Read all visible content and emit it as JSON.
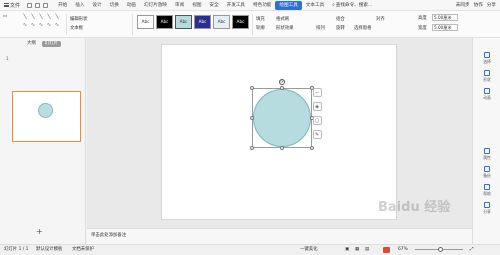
{
  "menubar": {
    "file_label": "文件",
    "tabs": [
      "开始",
      "插入",
      "设计",
      "切换",
      "动画",
      "幻灯片放映",
      "审阅",
      "视图",
      "安全",
      "开发工具",
      "特色功能",
      "绘图工具",
      "文本工具"
    ],
    "active_tab": "绘图工具",
    "search_label": "查找命令、搜索...",
    "right_items": [
      "未同步",
      "协作",
      "分享"
    ]
  },
  "ribbon": {
    "edit_shape": "编辑形状",
    "text_box": "文本框",
    "style_labels": [
      "Abc",
      "Abc",
      "Abc",
      "Abc",
      "Abc",
      "Abc"
    ],
    "fill_label": "填充",
    "outline_label": "轮廓",
    "shape_effect": "形状效果",
    "format_brush": "格式刷",
    "arrange": "排列",
    "group": "组合",
    "rotate": "旋转",
    "select_pane": "选择窗格",
    "align": "对齐",
    "height_label": "高度",
    "height_value": "5.00厘米",
    "width_label": "宽度",
    "width_value": "5.00厘米"
  },
  "left_panel": {
    "tab_outline": "大纲",
    "tab_slides": "幻灯片",
    "slide_number": "1",
    "add_slide": "+"
  },
  "canvas": {
    "notes_placeholder": "单击此处添加备注",
    "rotate_symbol": "⟳"
  },
  "right_bar": {
    "items": [
      "选择",
      "形状",
      "动画",
      "属性",
      "备份",
      "帮助",
      "分享"
    ]
  },
  "status": {
    "slide_info": "幻灯片 1 / 1",
    "theme": "默认设计模板",
    "backup": "文档未保护",
    "note_toggle": "一键美化",
    "zoom": "67%"
  },
  "watermark": "Baidu 经验",
  "colors": {
    "accent": "#2f6fd6",
    "circle_fill": "#b6dcdf",
    "thumb_border": "#f08b3c"
  }
}
